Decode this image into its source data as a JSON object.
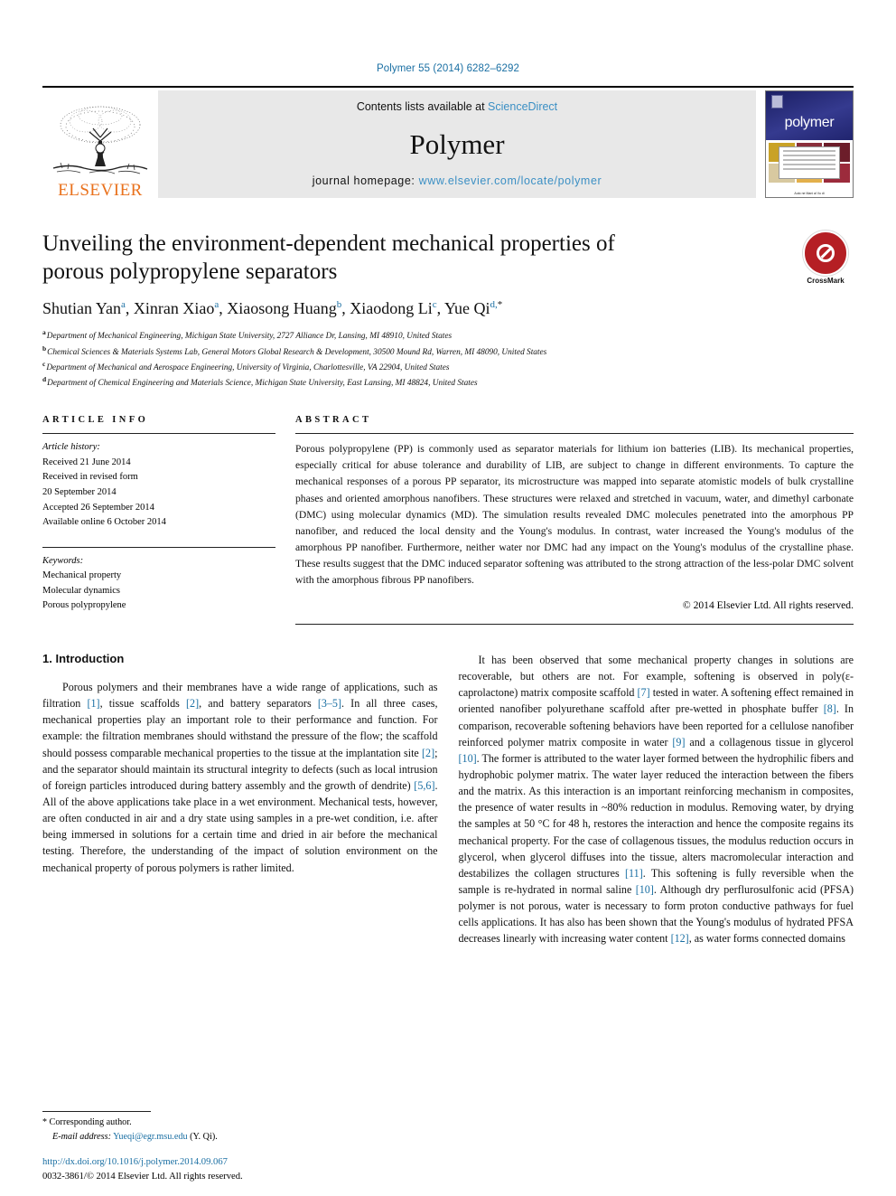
{
  "running_head": "Polymer 55 (2014) 6282–6292",
  "masthead": {
    "publisher": "ELSEVIER",
    "contents_prefix": "Contents lists available at ",
    "contents_link": "ScienceDirect",
    "journal_title": "Polymer",
    "homepage_prefix": "journal homepage: ",
    "homepage_url": "www.elsevier.com/locate/polymer",
    "cover_word": "polymer",
    "cover_footer": "Auto ne Mani al Vu di"
  },
  "article": {
    "title": "Unveiling the environment-dependent mechanical properties of porous polypropylene separators",
    "crossmark_label": "CrossMark",
    "authors": [
      {
        "name": "Shutian Yan",
        "marks": "a"
      },
      {
        "name": "Xinran Xiao",
        "marks": "a"
      },
      {
        "name": "Xiaosong Huang",
        "marks": "b"
      },
      {
        "name": "Xiaodong Li",
        "marks": "c"
      },
      {
        "name": "Yue Qi",
        "marks": "d",
        "corresponding": true
      }
    ],
    "affiliations": [
      {
        "mark": "a",
        "text": "Department of Mechanical Engineering, Michigan State University, 2727 Alliance Dr, Lansing, MI 48910, United States"
      },
      {
        "mark": "b",
        "text": "Chemical Sciences & Materials Systems Lab, General Motors Global Research & Development, 30500 Mound Rd, Warren, MI 48090, United States"
      },
      {
        "mark": "c",
        "text": "Department of Mechanical and Aerospace Engineering, University of Virginia, Charlottesville, VA 22904, United States"
      },
      {
        "mark": "d",
        "text": "Department of Chemical Engineering and Materials Science, Michigan State University, East Lansing, MI 48824, United States"
      }
    ]
  },
  "article_info": {
    "heading": "ARTICLE INFO",
    "history_label": "Article history:",
    "history": [
      "Received 21 June 2014",
      "Received in revised form",
      "20 September 2014",
      "Accepted 26 September 2014",
      "Available online 6 October 2014"
    ],
    "keywords_label": "Keywords:",
    "keywords": [
      "Mechanical property",
      "Molecular dynamics",
      "Porous polypropylene"
    ]
  },
  "abstract": {
    "heading": "ABSTRACT",
    "text": "Porous polypropylene (PP) is commonly used as separator materials for lithium ion batteries (LIB). Its mechanical properties, especially critical for abuse tolerance and durability of LIB, are subject to change in different environments. To capture the mechanical responses of a porous PP separator, its microstructure was mapped into separate atomistic models of bulk crystalline phases and oriented amorphous nanofibers. These structures were relaxed and stretched in vacuum, water, and dimethyl carbonate (DMC) using molecular dynamics (MD). The simulation results revealed DMC molecules penetrated into the amorphous PP nanofiber, and reduced the local density and the Young's modulus. In contrast, water increased the Young's modulus of the amorphous PP nanofiber. Furthermore, neither water nor DMC had any impact on the Young's modulus of the crystalline phase. These results suggest that the DMC induced separator softening was attributed to the strong attraction of the less-polar DMC solvent with the amorphous fibrous PP nanofibers.",
    "copyright": "© 2014 Elsevier Ltd. All rights reserved."
  },
  "introduction": {
    "number_title": "1. Introduction",
    "left_paragraph_parts": [
      "Porous polymers and their membranes have a wide range of applications, such as filtration ",
      "[1]",
      ", tissue scaffolds ",
      "[2]",
      ", and battery separators ",
      "[3–5]",
      ". In all three cases, mechanical properties play an important role to their performance and function. For example: the filtration membranes should withstand the pressure of the flow; the scaffold should possess comparable mechanical properties to the tissue at the implantation site ",
      "[2]",
      "; and the separator should maintain its structural integrity to defects (such as local intrusion of foreign particles introduced during battery assembly and the growth of dendrite) ",
      "[5,6]",
      ". All of the above applications take place in a wet environment. Mechanical tests, however, are often conducted in air and a dry state using samples in a pre-wet condition, i.e. after being immersed in solutions for a certain time and dried in air before the mechanical testing. Therefore, the understanding of the impact of solution environment on the mechanical property of porous polymers is rather limited."
    ],
    "right_paragraph_parts": [
      "It has been observed that some mechanical property changes in solutions are recoverable, but others are not. For example, softening is observed in poly(ε-caprolactone) matrix composite scaffold ",
      "[7]",
      " tested in water. A softening effect remained in oriented nanofiber polyurethane scaffold after pre-wetted in phosphate buffer ",
      "[8]",
      ". In comparison, recoverable softening behaviors have been reported for a cellulose nanofiber reinforced polymer matrix composite in water ",
      "[9]",
      " and a collagenous tissue in glycerol ",
      "[10]",
      ". The former is attributed to the water layer formed between the hydrophilic fibers and hydrophobic polymer matrix. The water layer reduced the interaction between the fibers and the matrix. As this interaction is an important reinforcing mechanism in composites, the presence of water results in ~80% reduction in modulus. Removing water, by drying the samples at 50 °C for 48 h, restores the interaction and hence the composite regains its mechanical property. For the case of collagenous tissues, the modulus reduction occurs in glycerol, when glycerol diffuses into the tissue, alters macromolecular interaction and destabilizes the collagen structures ",
      "[11]",
      ". This softening is fully reversible when the sample is re-hydrated in normal saline ",
      "[10]",
      ". Although dry perflurosulfonic acid (PFSA) polymer is not porous, water is necessary to form proton conductive pathways for fuel cells applications. It has also has been shown that the Young's modulus of hydrated PFSA decreases linearly with increasing water content ",
      "[12]",
      ", as water forms connected domains"
    ]
  },
  "footer": {
    "corresponding_star": "*",
    "corresponding_label": "Corresponding author.",
    "email_label": "E-mail address:",
    "email": "Yueqi@egr.msu.edu",
    "email_suffix": "(Y. Qi).",
    "doi": "http://dx.doi.org/10.1016/j.polymer.2014.09.067",
    "issn_line": "0032-3861/© 2014 Elsevier Ltd. All rights reserved."
  },
  "colors": {
    "link_blue": "#1a6fa3",
    "elsevier_orange": "#E9711C",
    "crossmark_red": "#b51f24",
    "masthead_gray": "#e8e8e8"
  }
}
